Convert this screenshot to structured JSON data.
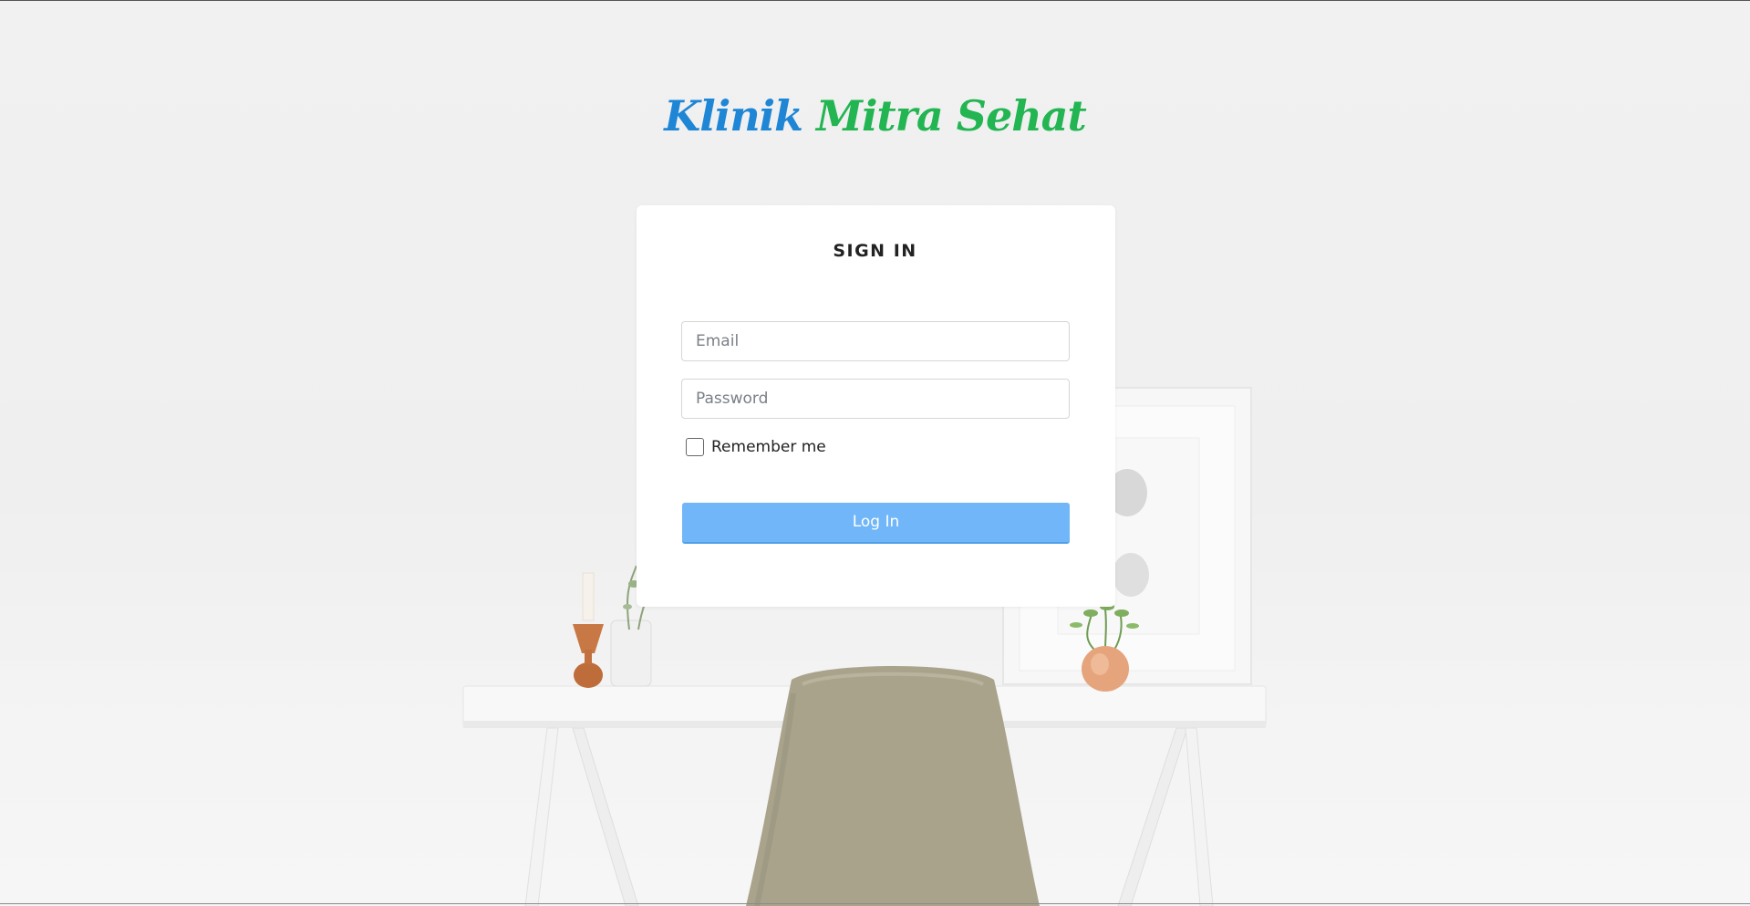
{
  "brand": {
    "word1": "Klinik",
    "word2": "Mitra Sehat",
    "color1": "#1f86d6",
    "color2": "#22b552"
  },
  "signin": {
    "title": "SIGN IN",
    "email_placeholder": "Email",
    "email_value": "",
    "password_placeholder": "Password",
    "password_value": "",
    "remember_label": "Remember me",
    "remember_checked": false,
    "login_label": "Log In",
    "accent": "#70b6f8"
  },
  "background": {
    "scene": "white desk with beige chair, candle holder, vase with plant, framed picture, potted plant"
  }
}
